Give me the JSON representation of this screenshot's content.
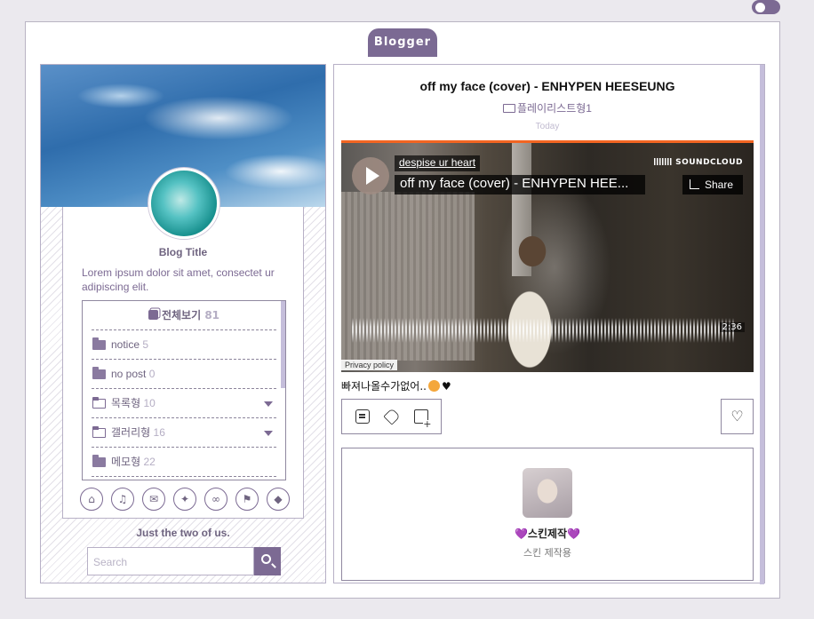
{
  "header": {
    "blog_tab": "Blogger"
  },
  "sidebar": {
    "blog_title": "Blog Title",
    "description": "Lorem ipsum dolor sit amet, consectet ur adipiscing elit.",
    "categories": {
      "all_label": "전체보기",
      "all_count": "81",
      "items": [
        {
          "label": "notice",
          "count": "5"
        },
        {
          "label": "no post",
          "count": "0"
        },
        {
          "label": "목록형",
          "count": "10"
        },
        {
          "label": "갤러리형",
          "count": "16"
        },
        {
          "label": "메모형",
          "count": "22"
        }
      ]
    },
    "icons": [
      "home-icon",
      "bell-icon",
      "mail-icon",
      "twitter-icon",
      "link-icon",
      "flag-icon",
      "tags-icon"
    ],
    "tagline": "Just the two of us.",
    "search": {
      "placeholder": "Search"
    }
  },
  "post": {
    "title": "off my face (cover) - ENHYPEN HEESEUNG",
    "category": "플레이리스트형1",
    "date": "Today",
    "player": {
      "artist": "despise ur heart",
      "track": "off my face (cover) - ENHYPEN HEE...",
      "brand": "SOUNDCLOUD",
      "share": "Share",
      "duration": "2:36",
      "privacy": "Privacy policy"
    },
    "caption": "빠져나올수가없어..",
    "author": {
      "name": "스킨제작",
      "subtitle": "스킨 제작용",
      "heart": "💜"
    }
  },
  "colors": {
    "accent": "#7b6a93",
    "soundcloud": "#f26522"
  }
}
